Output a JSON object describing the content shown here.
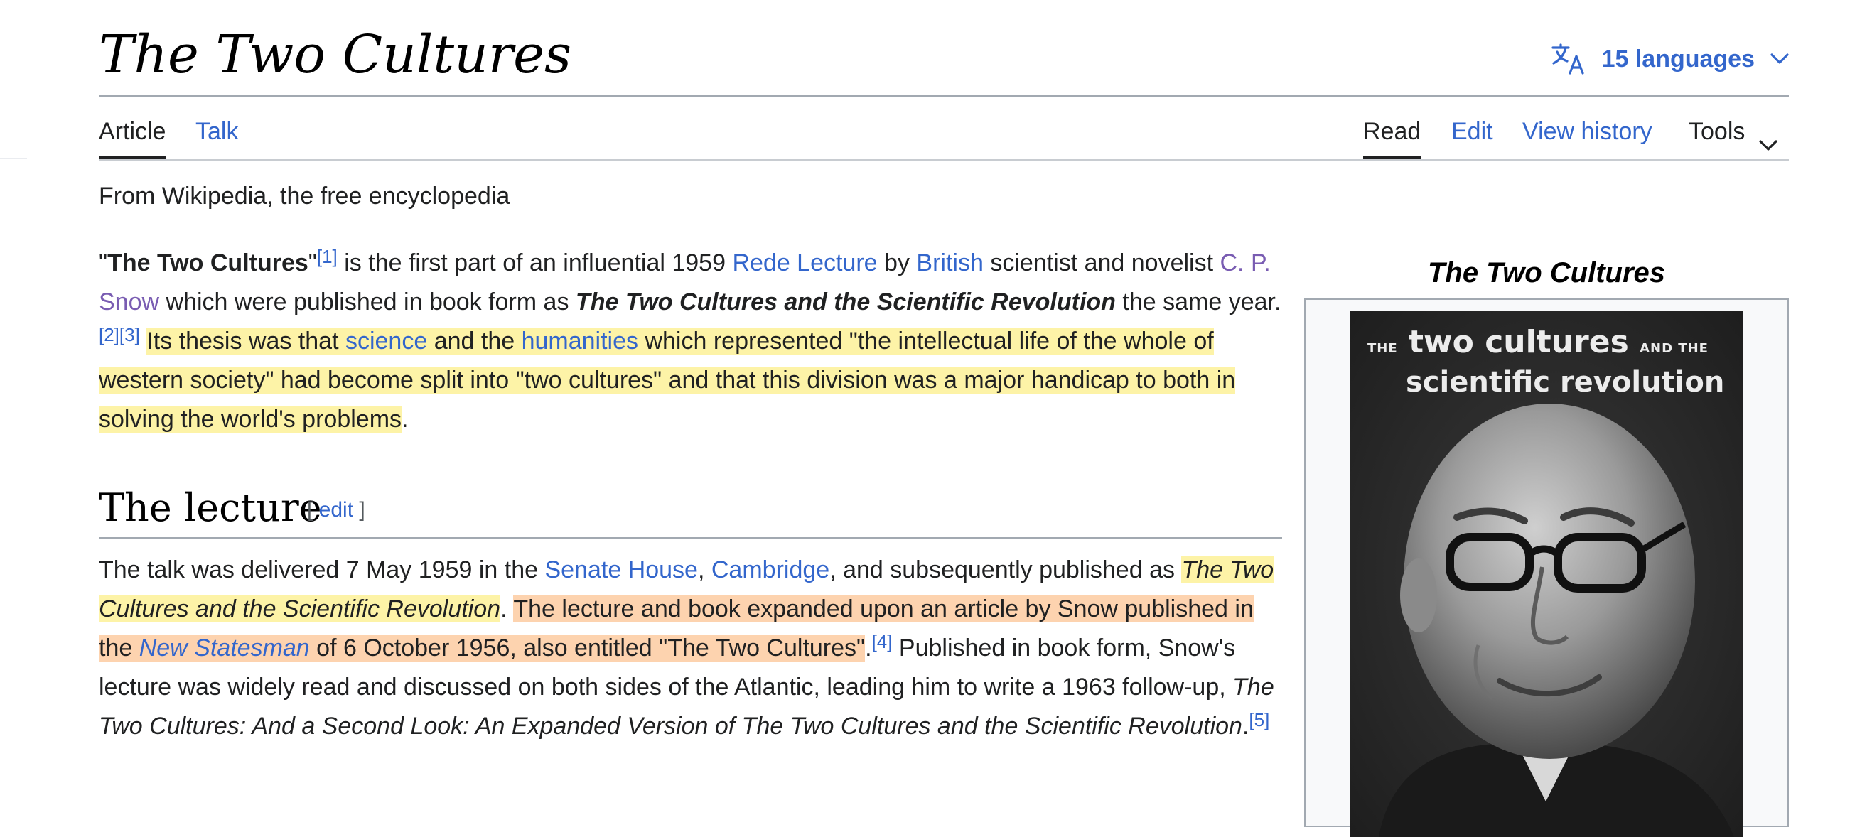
{
  "page": {
    "title": "The Two Cultures",
    "languages_label": "15 languages",
    "tagline": "From Wikipedia, the free encyclopedia"
  },
  "tabs": {
    "article": "Article",
    "talk": "Talk",
    "read": "Read",
    "edit": "Edit",
    "view_history": "View history",
    "tools": "Tools"
  },
  "intro": {
    "q1": "\"",
    "title_bold": "The Two Cultures",
    "q2": "\"",
    "ref1": "[1]",
    "t1": " is the first part of an influential 1959 ",
    "link_rede": "Rede Lecture",
    "t2": " by ",
    "link_british": "British",
    "t3": " scientist and novelist ",
    "link_snow": "C. P. Snow",
    "t4": " which were published in book form as ",
    "book_title": "The Two Cultures and the Scientific Revolution",
    "t5": " the same year.",
    "ref2": "[2]",
    "ref3": "[3]",
    "t6": " ",
    "h1": "Its thesis was that ",
    "link_science": "science",
    "h2": " and the ",
    "link_humanities": "humanities",
    "h3": " which represented \"the intellectual life of the whole of western society\" had become split into \"two cultures\" and that this division was a major handicap to both in solving the world's problems",
    "t7": "."
  },
  "section": {
    "heading": "The lecture",
    "edit_open": "[ ",
    "edit_label": "edit",
    "edit_close": " ]"
  },
  "lecture": {
    "t1": "The talk was delivered 7 May 1959 in the ",
    "link_senate": "Senate House",
    "t2": ", ",
    "link_cambridge": "Cambridge",
    "t3": ", and subsequently published as ",
    "book_title": "The Two Cultures and the Scientific Revolution",
    "t4": ". ",
    "o1": "The lecture and book expanded upon an article by Snow published in the ",
    "link_newstatesman": "New Statesman",
    "o2": " of 6 October 1956, also entitled \"The Two Cultures\"",
    "t5": ".",
    "ref4": "[4]",
    "t6": " Published in book form, Snow's lecture was widely read and discussed on both sides of the Atlantic, leading him to write a 1963 follow-up, ",
    "followup_title": "The Two Cultures: And a Second Look: An Expanded Version of The Two Cultures and the Scientific Revolution",
    "t7": ".",
    "ref5": "[5]"
  },
  "infobox": {
    "caption": "The Two Cultures",
    "cover_line1_the": "THE",
    "cover_line1_main": " two cultures ",
    "cover_line1_and": "AND THE",
    "cover_line2": "scientific revolution"
  },
  "colors": {
    "link": "#3366cc",
    "visited_link": "#795cb2",
    "highlight_yellow": "#fdf3a7",
    "highlight_orange": "#fdd3af"
  }
}
